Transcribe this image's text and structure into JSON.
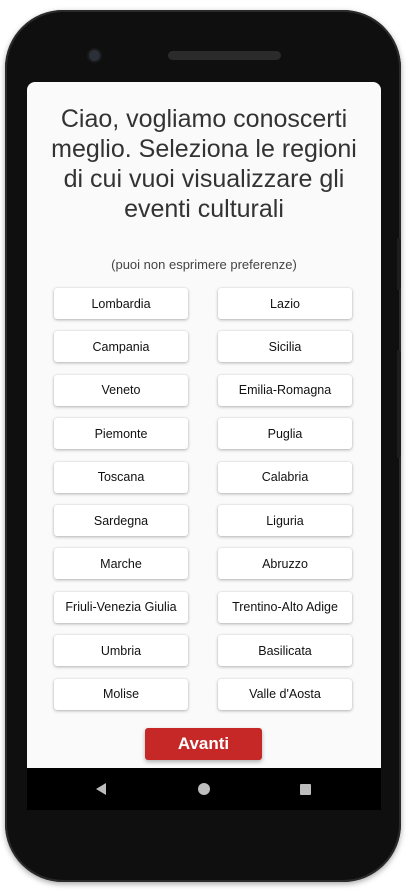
{
  "screen": {
    "heading": "Ciao, vogliamo conoscerti meglio. Seleziona le regioni di cui vuoi visualizzare gli eventi culturali",
    "subheading": "(puoi non esprimere preferenze)"
  },
  "regions": [
    "Lombardia",
    "Lazio",
    "Campania",
    "Sicilia",
    "Veneto",
    "Emilia-Romagna",
    "Piemonte",
    "Puglia",
    "Toscana",
    "Calabria",
    "Sardegna",
    "Liguria",
    "Marche",
    "Abruzzo",
    "Friuli-Venezia Giulia",
    "Trentino-Alto Adige",
    "Umbria",
    "Basilicata",
    "Molise",
    "Valle d'Aosta"
  ],
  "actions": {
    "next_label": "Avanti"
  },
  "navbar": {
    "back_icon": "back-triangle-icon",
    "home_icon": "home-circle-icon",
    "recents_icon": "recents-square-icon"
  },
  "colors": {
    "accent": "#c62828",
    "background": "#fafafa",
    "button": "#ffffff"
  }
}
